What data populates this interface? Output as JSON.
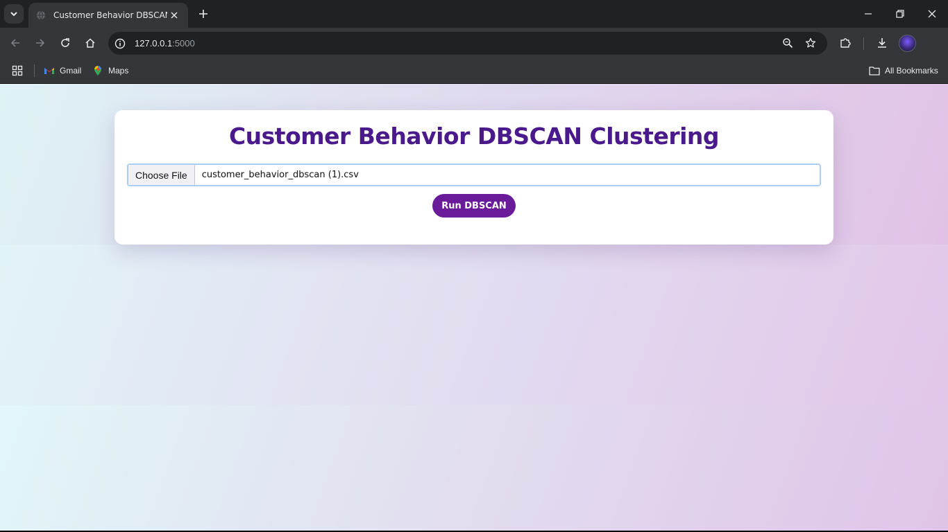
{
  "browser": {
    "tab_title": "Customer Behavior DBSCAN",
    "url_host": "127.0.0.1",
    "url_port": ":5000",
    "bookmarks": [
      {
        "label": "Gmail",
        "icon": "gmail-icon"
      },
      {
        "label": "Maps",
        "icon": "maps-icon"
      }
    ],
    "all_bookmarks_label": "All Bookmarks"
  },
  "page": {
    "title": "Customer Behavior DBSCAN Clustering",
    "choose_file_label": "Choose File",
    "selected_file": "customer_behavior_dbscan (1).csv",
    "run_button_label": "Run DBSCAN"
  },
  "colors": {
    "accent": "#6a1b9a",
    "title": "#4a1a8c",
    "chrome_dark": "#202124",
    "chrome_toolbar": "#35363a"
  }
}
